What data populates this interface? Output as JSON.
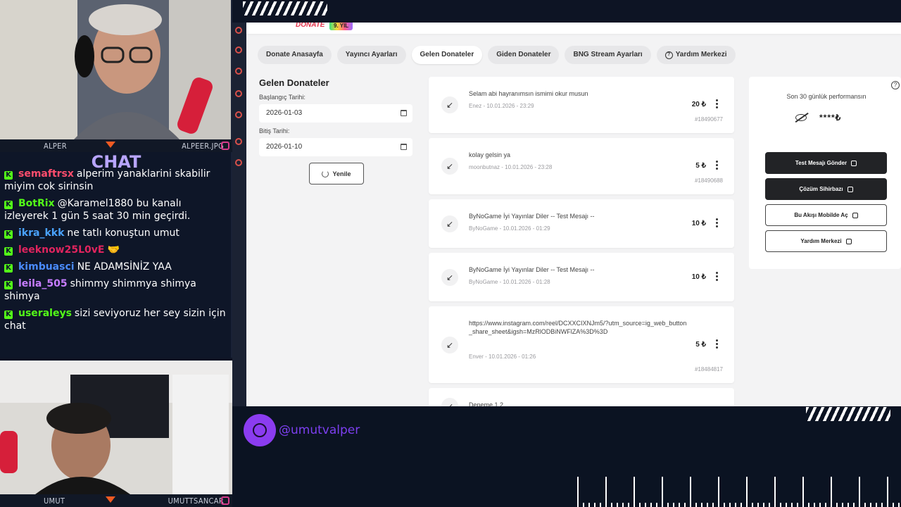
{
  "overlay": {
    "cam_top": {
      "left_name": "ALPER",
      "right_name": "ALPEER.JPG"
    },
    "cam_bottom": {
      "left_name": "UMUT",
      "right_name": "UMUTTSANCAR"
    },
    "chat_title": "CHAT",
    "chat_messages": [
      {
        "user": "semaftrsx",
        "color": "#ff4d6d",
        "text": "alperim yanaklarini skabilir miyim cok sirinsin"
      },
      {
        "user": "BotRix",
        "color": "#53fc18",
        "text": "@Karamel1880 bu kanalı izleyerek 1 gün 5 saat 30 min geçirdi."
      },
      {
        "user": "ikra_kkk",
        "color": "#4aa3ff",
        "text": "ne tatlı konuştun umut"
      },
      {
        "user": "leeknow25L0vE",
        "color": "#e0245e",
        "text": "🤝"
      },
      {
        "user": "kimbuasci",
        "color": "#4a8bff",
        "text": "NE ADAMSİNİZ YAA"
      },
      {
        "user": "leila_505",
        "color": "#c77dff",
        "text": "shimmy shimmya shimya shimya"
      },
      {
        "user": "useraleys",
        "color": "#53fc18",
        "text": "sizi seviyoruz her sey sizin için chat"
      }
    ],
    "handle": "@umutvalper",
    "colors": {
      "accent": "#8b3cf0",
      "kick_green": "#53fc18"
    }
  },
  "site": {
    "logo": "DONATE",
    "year_badge": "9. YIL",
    "tabs": [
      {
        "label": "Donate Anasayfa"
      },
      {
        "label": "Yayıncı Ayarları"
      },
      {
        "label": "Gelen Donateler",
        "active": true
      },
      {
        "label": "Giden Donateler"
      },
      {
        "label": "BNG Stream Ayarları"
      },
      {
        "label": "Yardım Merkezi",
        "icon": "question-circle-icon"
      }
    ],
    "filters": {
      "title": "Gelen Donateler",
      "start_label": "Başlangıç Tarihi:",
      "start_value": "2026-01-03",
      "end_label": "Bitiş Tarihi:",
      "end_value": "2026-01-10",
      "refresh_label": "Yenile"
    },
    "donations": [
      {
        "message": "Selam abi hayranımsın ismimi okur musun",
        "meta": "Enez - 10.01.2026 - 23:29",
        "amount": "20 ₺",
        "id": "#18490677"
      },
      {
        "message": "kolay gelsin ya",
        "meta": "moonbutnaz - 10.01.2026 - 23:28",
        "amount": "5 ₺",
        "id": "#18490688"
      },
      {
        "message": "ByNoGame İyi Yayınlar Diler -- Test Mesajı --",
        "meta": "ByNoGame - 10.01.2026 - 01:29",
        "amount": "10 ₺",
        "id": ""
      },
      {
        "message": "ByNoGame İyi Yayınlar Diler -- Test Mesajı --",
        "meta": "ByNoGame - 10.01.2026 - 01:28",
        "amount": "10 ₺",
        "id": ""
      },
      {
        "message": "https://www.instagram.com/reel/DCXXCIXNJm5/?utm_source=ig_web_button_share_sheet&igsh=MzRlODBiNWFlZA%3D%3D",
        "meta": "Enver - 10.01.2026 - 01:26",
        "amount": "5 ₺",
        "id": "#18484817"
      },
      {
        "message": "Deneme 1 2",
        "meta": "",
        "amount": "",
        "id": ""
      }
    ],
    "performance": {
      "title": "Son 30 günlük performansın",
      "hidden_value": "****₺",
      "buttons": [
        {
          "label": "Test Mesajı Gönder",
          "style": "dark"
        },
        {
          "label": "Çözüm Sihirbazı",
          "style": "dark"
        },
        {
          "label": "Bu Akışı Mobilde Aç",
          "style": "light"
        },
        {
          "label": "Yardım Merkezi",
          "style": "light"
        }
      ]
    }
  }
}
